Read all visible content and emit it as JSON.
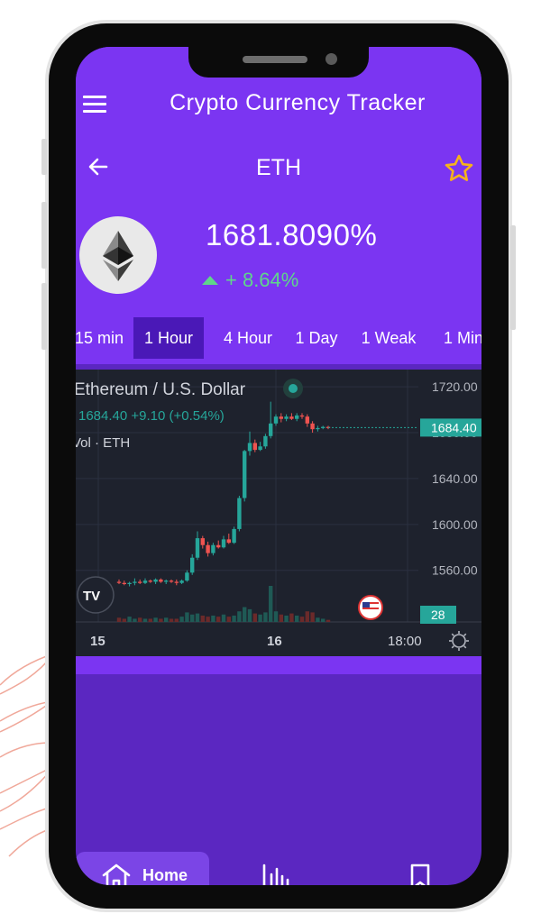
{
  "app": {
    "title": "Crypto Currency Tracker"
  },
  "coin": {
    "symbol": "ETH",
    "price": "1681.8090%",
    "change": "+ 8.64%",
    "change_direction": "up",
    "logo_icon": "ethereum-logo",
    "favorite_icon": "star-outline-icon"
  },
  "tabs": [
    {
      "label": "15 min",
      "active": false
    },
    {
      "label": "1 Hour",
      "active": true
    },
    {
      "label": "4 Hour",
      "active": false
    },
    {
      "label": "1 Day",
      "active": false
    },
    {
      "label": "1 Weak",
      "active": false
    },
    {
      "label": "1 Min",
      "active": false
    }
  ],
  "chart_data": {
    "type": "candlestick",
    "title": "Ethereum / U.S. Dollar",
    "quote": {
      "last": "1684.40",
      "change": "+9.10",
      "change_pct": "(+0.54%)"
    },
    "volume_label": "Vol · ETH",
    "price_axis": {
      "ticks": [
        "1720.00",
        "1680.00",
        "1640.00",
        "1600.00",
        "1560.00"
      ],
      "range": [
        1515,
        1735
      ]
    },
    "time_axis": {
      "ticks": [
        "15",
        "16",
        "18:00"
      ]
    },
    "last_price_tag": "1684.40",
    "volume_tag": "28",
    "candles": [
      {
        "o": 1550,
        "h": 1552,
        "l": 1548,
        "c": 1549
      },
      {
        "o": 1549,
        "h": 1551,
        "l": 1547,
        "c": 1548
      },
      {
        "o": 1548,
        "h": 1550,
        "l": 1546,
        "c": 1549
      },
      {
        "o": 1549,
        "h": 1553,
        "l": 1547,
        "c": 1550
      },
      {
        "o": 1550,
        "h": 1552,
        "l": 1548,
        "c": 1549
      },
      {
        "o": 1549,
        "h": 1553,
        "l": 1548,
        "c": 1551
      },
      {
        "o": 1551,
        "h": 1552,
        "l": 1549,
        "c": 1550
      },
      {
        "o": 1550,
        "h": 1553,
        "l": 1548,
        "c": 1552
      },
      {
        "o": 1552,
        "h": 1553,
        "l": 1549,
        "c": 1550
      },
      {
        "o": 1550,
        "h": 1552,
        "l": 1548,
        "c": 1551
      },
      {
        "o": 1551,
        "h": 1552,
        "l": 1549,
        "c": 1550
      },
      {
        "o": 1550,
        "h": 1552,
        "l": 1547,
        "c": 1549
      },
      {
        "o": 1549,
        "h": 1552,
        "l": 1548,
        "c": 1551
      },
      {
        "o": 1551,
        "h": 1560,
        "l": 1550,
        "c": 1558
      },
      {
        "o": 1558,
        "h": 1574,
        "l": 1556,
        "c": 1571
      },
      {
        "o": 1571,
        "h": 1594,
        "l": 1569,
        "c": 1588
      },
      {
        "o": 1588,
        "h": 1590,
        "l": 1579,
        "c": 1582
      },
      {
        "o": 1582,
        "h": 1585,
        "l": 1572,
        "c": 1575
      },
      {
        "o": 1575,
        "h": 1584,
        "l": 1573,
        "c": 1582
      },
      {
        "o": 1582,
        "h": 1586,
        "l": 1579,
        "c": 1580
      },
      {
        "o": 1580,
        "h": 1590,
        "l": 1579,
        "c": 1587
      },
      {
        "o": 1587,
        "h": 1592,
        "l": 1583,
        "c": 1584
      },
      {
        "o": 1584,
        "h": 1598,
        "l": 1583,
        "c": 1596
      },
      {
        "o": 1596,
        "h": 1625,
        "l": 1594,
        "c": 1623
      },
      {
        "o": 1623,
        "h": 1665,
        "l": 1620,
        "c": 1664
      },
      {
        "o": 1664,
        "h": 1681,
        "l": 1660,
        "c": 1671
      },
      {
        "o": 1671,
        "h": 1674,
        "l": 1663,
        "c": 1665
      },
      {
        "o": 1665,
        "h": 1672,
        "l": 1664,
        "c": 1668
      },
      {
        "o": 1668,
        "h": 1679,
        "l": 1666,
        "c": 1677
      },
      {
        "o": 1677,
        "h": 1707,
        "l": 1675,
        "c": 1688
      },
      {
        "o": 1688,
        "h": 1696,
        "l": 1686,
        "c": 1694
      },
      {
        "o": 1694,
        "h": 1697,
        "l": 1689,
        "c": 1692
      },
      {
        "o": 1692,
        "h": 1696,
        "l": 1690,
        "c": 1694
      },
      {
        "o": 1694,
        "h": 1697,
        "l": 1691,
        "c": 1692
      },
      {
        "o": 1692,
        "h": 1697,
        "l": 1690,
        "c": 1695
      },
      {
        "o": 1695,
        "h": 1697,
        "l": 1692,
        "c": 1694
      },
      {
        "o": 1694,
        "h": 1696,
        "l": 1685,
        "c": 1688
      },
      {
        "o": 1688,
        "h": 1690,
        "l": 1680,
        "c": 1683
      },
      {
        "o": 1683,
        "h": 1686,
        "l": 1681,
        "c": 1684
      },
      {
        "o": 1684,
        "h": 1686,
        "l": 1683,
        "c": 1685
      },
      {
        "o": 1685,
        "h": 1686,
        "l": 1683,
        "c": 1684
      }
    ],
    "volumes": [
      4,
      3,
      5,
      3,
      4,
      3,
      3,
      4,
      3,
      4,
      3,
      3,
      5,
      9,
      7,
      8,
      6,
      5,
      6,
      5,
      7,
      5,
      6,
      10,
      14,
      12,
      8,
      7,
      9,
      34,
      10,
      7,
      6,
      8,
      6,
      5,
      10,
      9,
      4,
      3,
      2
    ],
    "colors": {
      "up": "#26a69a",
      "down": "#ef5350",
      "background": "#1e222d",
      "grid": "#2b3040",
      "text": "#d1d4dc"
    }
  },
  "bottom_nav": {
    "home_label": "Home",
    "items": [
      "home-icon",
      "bar-chart-icon",
      "bookmark-icon"
    ]
  },
  "colors": {
    "primary": "#7b35f2",
    "primary_dark": "#5b27c1",
    "tab_active": "#4a18b7",
    "positive": "#5fd68a",
    "star": "#f6b21b"
  }
}
